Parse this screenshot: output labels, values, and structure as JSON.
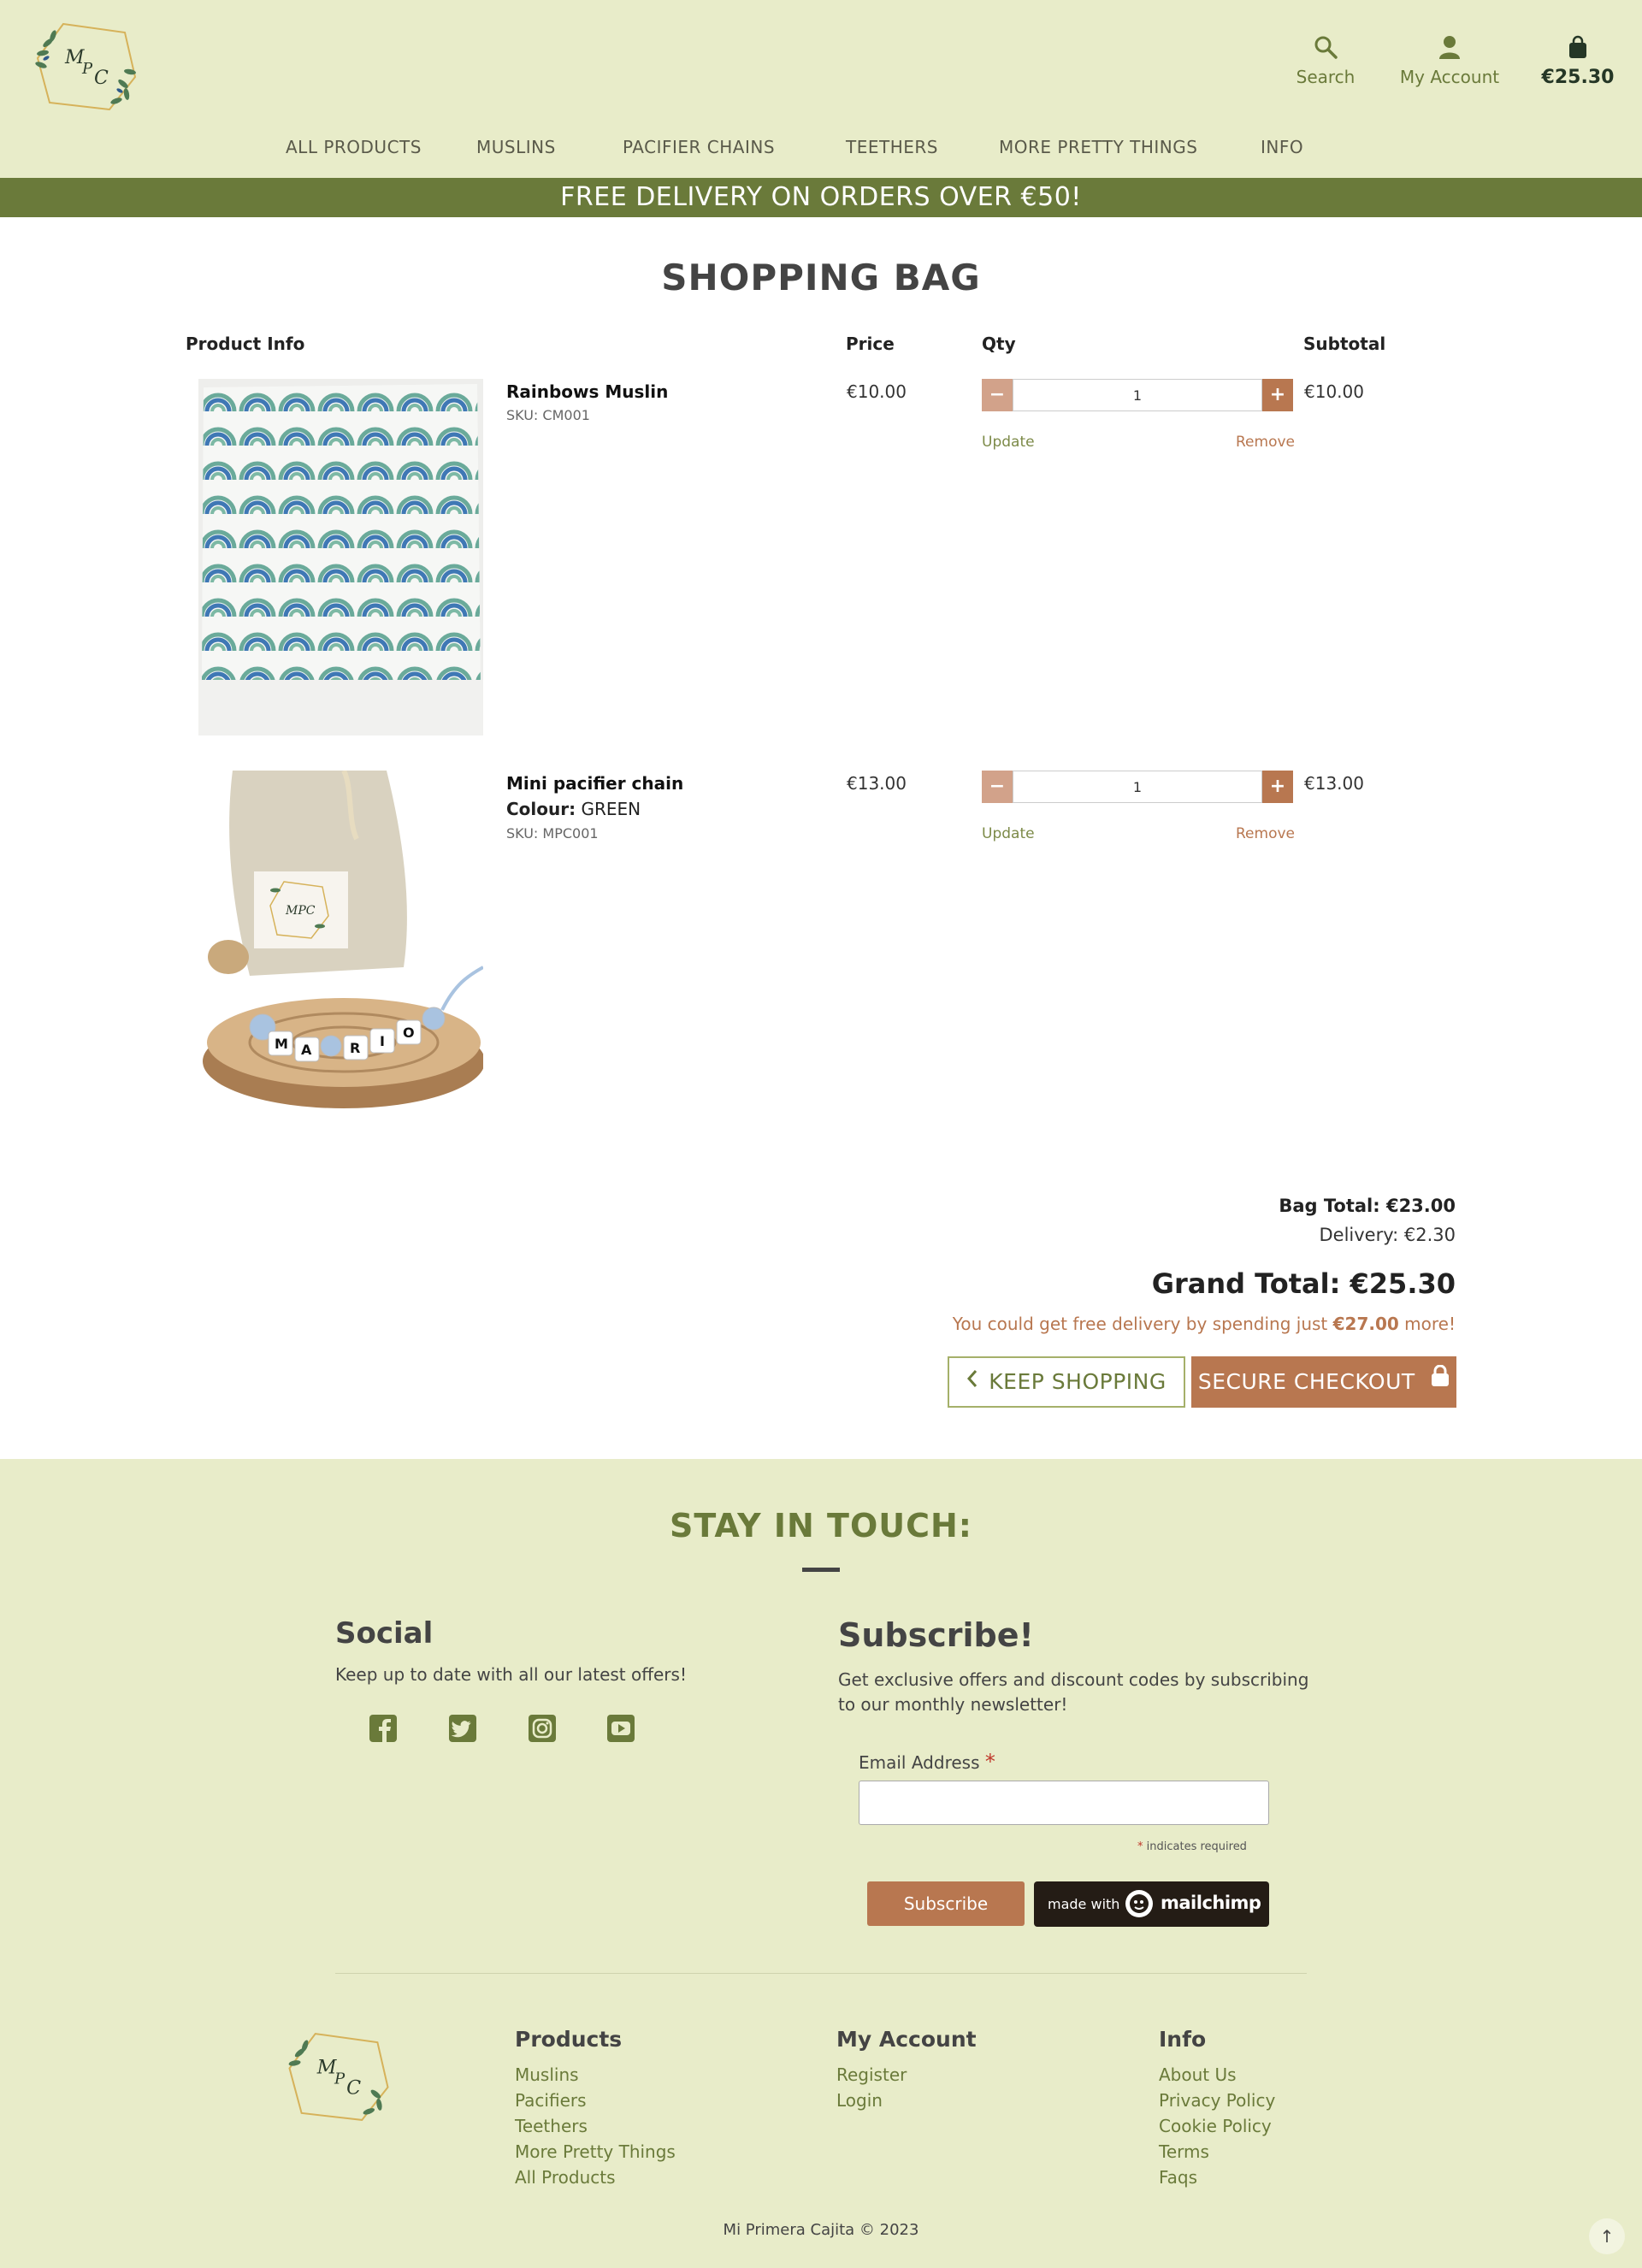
{
  "header": {
    "search_label": "Search",
    "account_label": "My Account",
    "bag_total": "€25.30"
  },
  "nav": {
    "items": [
      "ALL PRODUCTS",
      "MUSLINS",
      "PACIFIER CHAINS",
      "TEETHERS",
      "MORE PRETTY THINGS",
      "INFO"
    ]
  },
  "promo_banner": "FREE DELIVERY ON ORDERS OVER €50!",
  "bag": {
    "title": "SHOPPING BAG",
    "columns": {
      "product_info": "Product Info",
      "price": "Price",
      "qty": "Qty",
      "subtotal": "Subtotal"
    },
    "items": [
      {
        "name": "Rainbows Muslin",
        "sku": "SKU: CM001",
        "price": "€10.00",
        "qty": "1",
        "subtotal": "€10.00",
        "update": "Update",
        "remove": "Remove"
      },
      {
        "name": "Mini pacifier chain",
        "colour_label": "Colour:",
        "colour_value": "GREEN",
        "sku": "SKU: MPC001",
        "price": "€13.00",
        "qty": "1",
        "subtotal": "€13.00",
        "update": "Update",
        "remove": "Remove"
      }
    ],
    "bag_total": "Bag Total: €23.00",
    "delivery": "Delivery: €2.30",
    "grand_total": "Grand Total: €25.30",
    "free_delivery_prefix": "You could get free delivery by spending just",
    "free_delivery_amount": "€27.00",
    "free_delivery_suffix": "more!",
    "keep_shopping": "KEEP SHOPPING",
    "secure_checkout": "SECURE CHECKOUT"
  },
  "footer": {
    "stay_title": "STAY IN TOUCH:",
    "social": {
      "heading": "Social",
      "text": "Keep up to date with all our latest offers!",
      "icons": [
        "facebook-icon",
        "twitter-icon",
        "instagram-icon",
        "youtube-icon"
      ]
    },
    "subscribe": {
      "heading": "Subscribe!",
      "text": "Get exclusive offers and discount codes by subscribing to our monthly newsletter!",
      "email_label": "Email Address",
      "required_star": "*",
      "required_note": "indicates required",
      "button": "Subscribe",
      "badge_made_with": "made with",
      "badge_brand": "mailchimp"
    },
    "columns": {
      "products": {
        "heading": "Products",
        "links": [
          "Muslins",
          "Pacifiers",
          "Teethers",
          "More Pretty Things",
          "All Products"
        ]
      },
      "account": {
        "heading": "My Account",
        "links": [
          "Register",
          "Login"
        ]
      },
      "info": {
        "heading": "Info",
        "links": [
          "About Us",
          "Privacy Policy",
          "Cookie Policy",
          "Terms",
          "Faqs"
        ]
      }
    },
    "copyright": "Mi Primera Cajita © 2023"
  },
  "colors": {
    "sage_background": "#e8ecc9",
    "olive": "#6a7a3a",
    "terracotta": "#b87750"
  }
}
